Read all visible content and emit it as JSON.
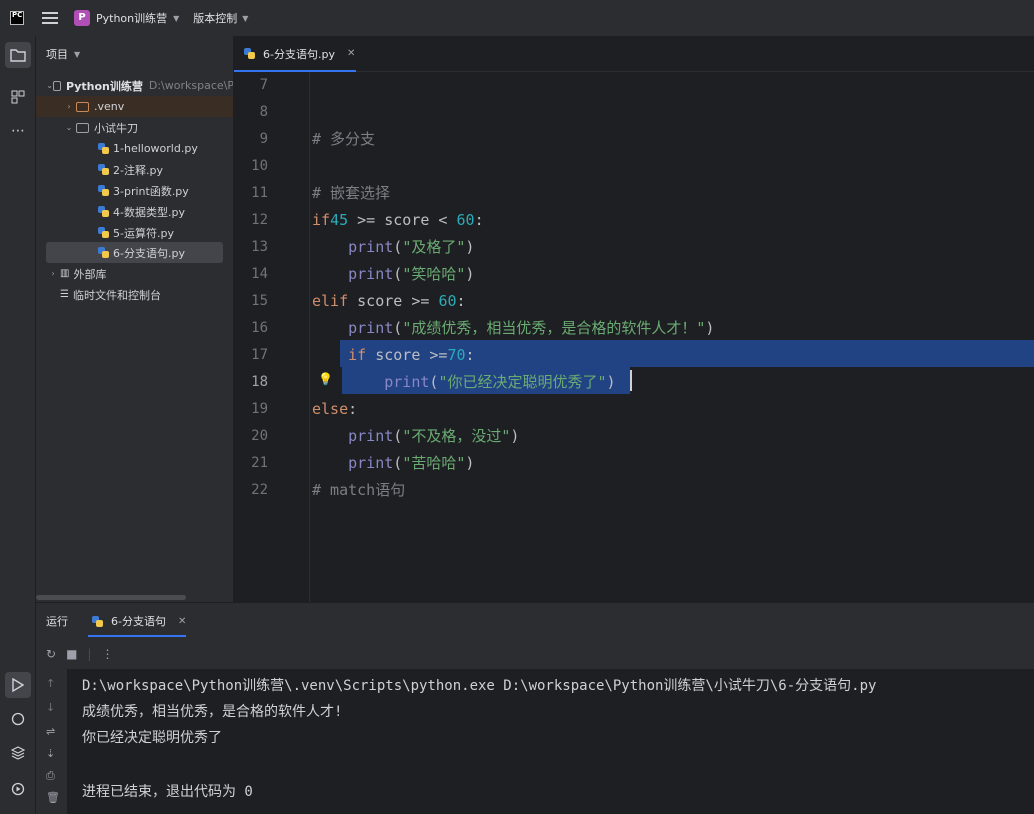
{
  "titlebar": {
    "logo": "PC",
    "project_initial": "P",
    "project_name": "Python训练营",
    "vcs_label": "版本控制"
  },
  "project_panel": {
    "title": "项目",
    "tree": [
      {
        "label": "Python训练营",
        "hint": "D:\\workspace\\P"
      },
      {
        "label": ".venv"
      },
      {
        "label": "小试牛刀"
      },
      {
        "label": "1-helloworld.py"
      },
      {
        "label": "2-注释.py"
      },
      {
        "label": "3-print函数.py"
      },
      {
        "label": "4-数据类型.py"
      },
      {
        "label": "5-运算符.py"
      },
      {
        "label": "6-分支语句.py"
      },
      {
        "label": "外部库"
      },
      {
        "label": "临时文件和控制台"
      }
    ]
  },
  "editor": {
    "tab_label": "6-分支语句.py",
    "lines": [
      {
        "num": "7"
      },
      {
        "num": "8"
      },
      {
        "num": "9",
        "comment": "# 多分支"
      },
      {
        "num": "10"
      },
      {
        "num": "11",
        "comment": "# 嵌套选择"
      },
      {
        "num": "12",
        "kw": "if",
        "num_a": "45",
        "mid": " >= score < ",
        "num_b": "60",
        "tail": ":"
      },
      {
        "num": "13",
        "indent": "    ",
        "fn": "print",
        "open": "(",
        "str": "\"及格了\"",
        "close": ")"
      },
      {
        "num": "14",
        "indent": "    ",
        "fn": "print",
        "open": "(",
        "str": "\"笑哈哈\"",
        "close": ")"
      },
      {
        "num": "15",
        "kw": "elif",
        "mid": " score >= ",
        "num_b": "60",
        "tail": ":"
      },
      {
        "num": "16",
        "indent": "    ",
        "fn": "print",
        "open": "(",
        "str": "\"成绩优秀，相当优秀，是合格的软件人才！\"",
        "close": ")"
      },
      {
        "num": "17",
        "indent": "    ",
        "kw": "if",
        "mid": " score >=",
        "num_b": "70",
        "tail": ":"
      },
      {
        "num": "18",
        "indent": "        ",
        "fn": "print",
        "open": "(",
        "str": "\"你已经决定聪明优秀了\"",
        "close": ")"
      },
      {
        "num": "19",
        "kw": "else",
        "tail": ":"
      },
      {
        "num": "20",
        "indent": "    ",
        "fn": "print",
        "open": "(",
        "str": "\"不及格，没过\"",
        "close": ")"
      },
      {
        "num": "21",
        "indent": "    ",
        "fn": "print",
        "open": "(",
        "str": "\"苦哈哈\"",
        "close": ")"
      },
      {
        "num": "22",
        "comment": "# match语句"
      }
    ]
  },
  "run_panel": {
    "label": "运行",
    "tab_label": "6-分支语句",
    "console": [
      "D:\\workspace\\Python训练营\\.venv\\Scripts\\python.exe D:\\workspace\\Python训练营\\小试牛刀\\6-分支语句.py",
      "成绩优秀，相当优秀，是合格的软件人才!",
      "你已经决定聪明优秀了",
      "",
      "进程已结束，退出代码为 0"
    ]
  }
}
